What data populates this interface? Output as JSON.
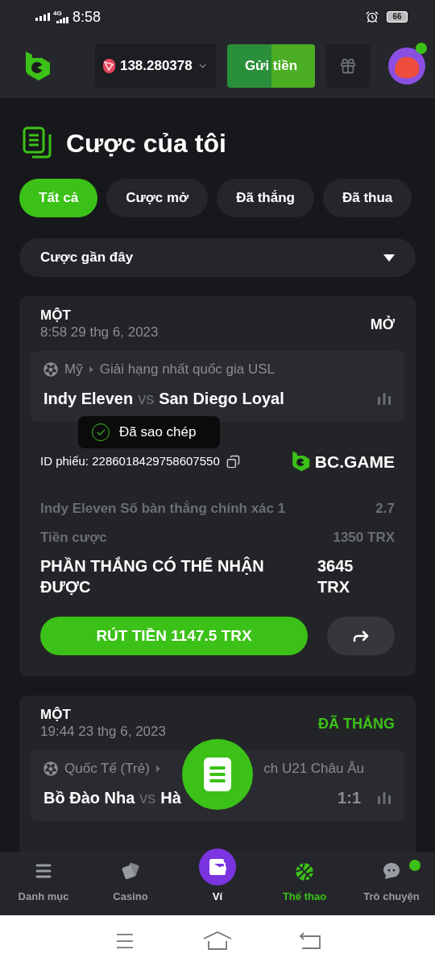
{
  "status_bar": {
    "network": "4G",
    "time": "8:58",
    "battery": "66"
  },
  "header": {
    "balance": "138.280378",
    "deposit_button": "Gửi tiền",
    "avatar_notification": true
  },
  "page_title": "Cược của tôi",
  "filter_tabs": [
    {
      "label": "Tất cả",
      "selected": true
    },
    {
      "label": "Cược mở",
      "selected": false
    },
    {
      "label": "Đã thắng",
      "selected": false
    },
    {
      "label": "Đã thua",
      "selected": false
    }
  ],
  "sort_dropdown": {
    "value": "Cược gần đây"
  },
  "bets": [
    {
      "type": "MỘT",
      "date": "8:58 29 thg 6, 2023",
      "status": "MỞ",
      "color": "#ffffff",
      "country": "Mỹ",
      "league": "Giải hạng nhất quốc gia USL",
      "team_home": "Indy Eleven",
      "vs": "vs",
      "team_away": "San Diego Loyal",
      "ticket_id_label": "ID phiếu:",
      "ticket_id": "2286018429758607550",
      "brand": "BC.GAME",
      "selection": "Indy Eleven Số bàn thắng chính xác 1",
      "odds": "2.7",
      "stake_label": "Tiền cược",
      "stake": "1350 TRX",
      "payout_label": "PHẦN THẮNG CÓ THỂ NHẬN ĐƯỢC",
      "payout": "3645 TRX",
      "cashout_button": "RÚT TIỀN 1147.5 TRX"
    },
    {
      "type": "MỘT",
      "date": "19:44 23 thg 6, 2023",
      "status": "ĐÃ THẮNG",
      "color": "#3bc117",
      "country": "Quốc Tế (Trẻ)",
      "league": "ch U21 Châu Âu",
      "team_home": "Bồ Đào Nha",
      "vs": "vs",
      "team_away": "Hà",
      "score": "1:1"
    }
  ],
  "toast": {
    "text": "Đã sao chép"
  },
  "bottom_nav": [
    {
      "label": "Danh mục",
      "kind": "menu",
      "selected": false,
      "notification": false
    },
    {
      "label": "Casino",
      "kind": "casino",
      "selected": false,
      "notification": false
    },
    {
      "label": "Ví",
      "kind": "wallet",
      "selected": false,
      "notification": false
    },
    {
      "label": "Thể thao",
      "kind": "sports",
      "selected": true,
      "notification": false
    },
    {
      "label": "Trò chuyện",
      "kind": "chat",
      "selected": false,
      "notification": true
    }
  ]
}
